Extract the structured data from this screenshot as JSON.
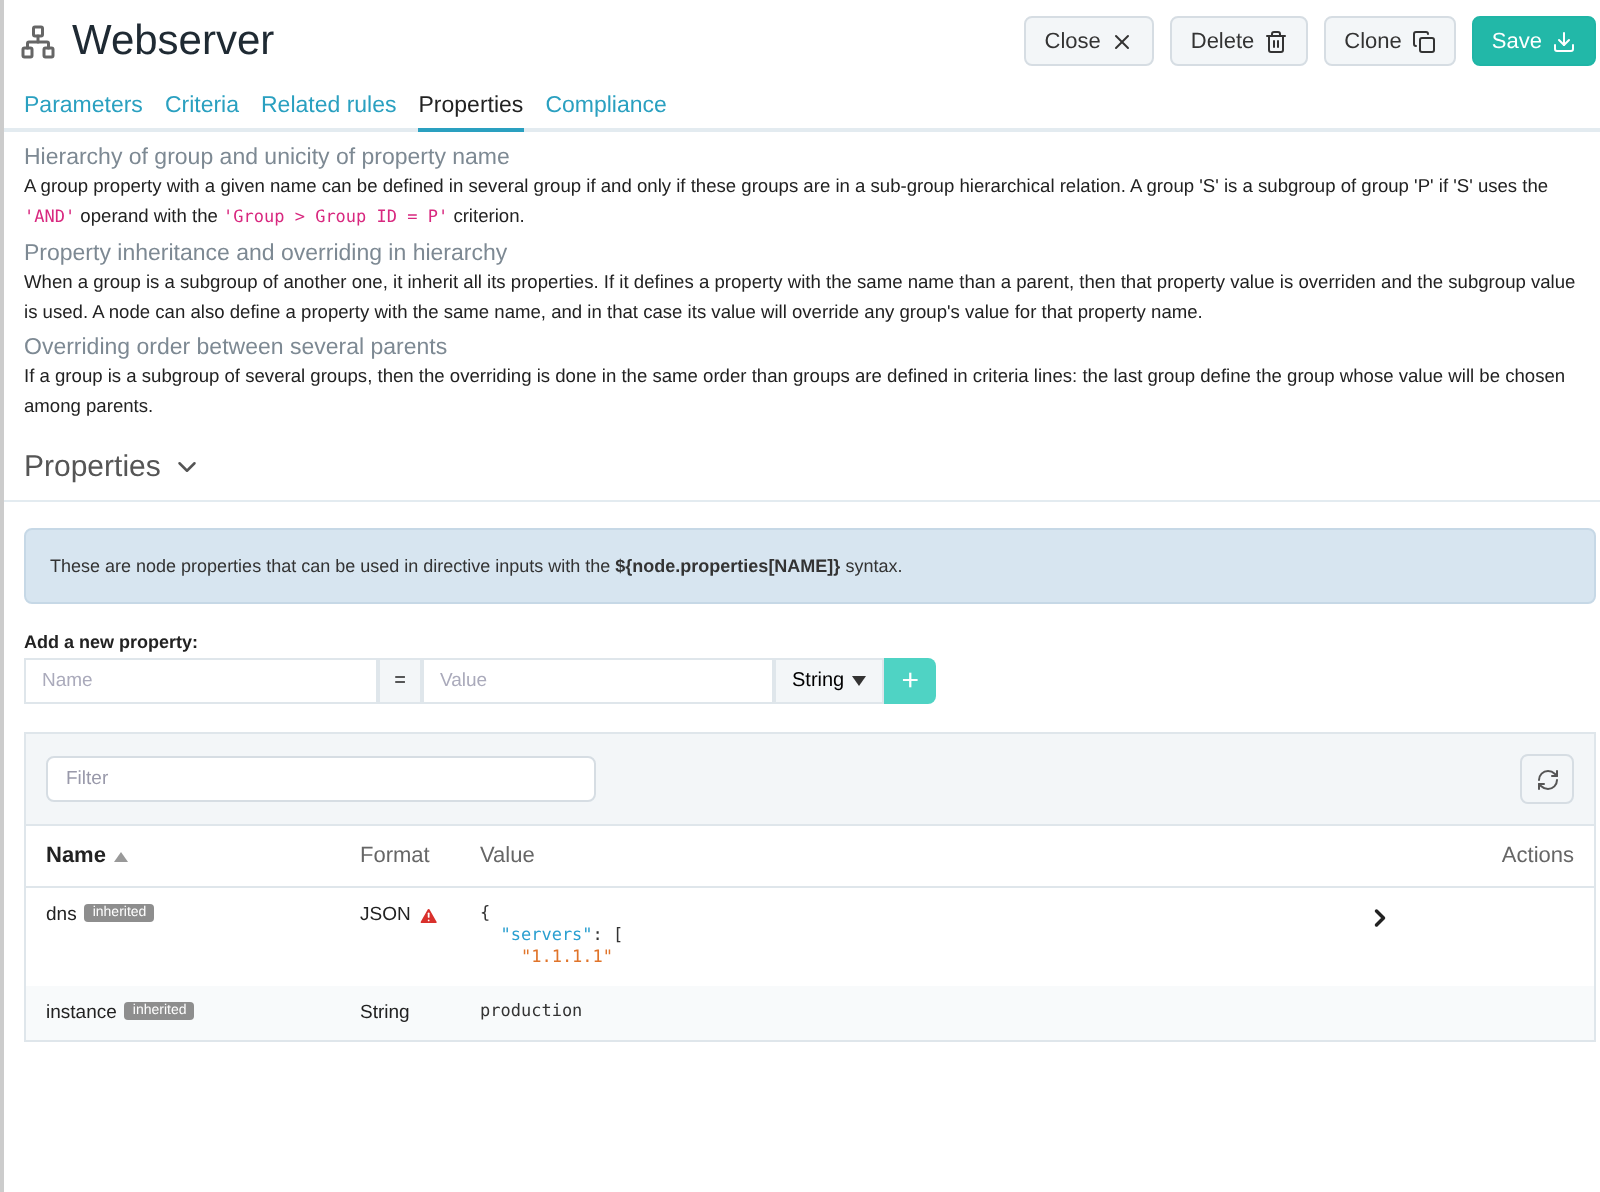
{
  "header": {
    "title": "Webserver",
    "buttons": [
      {
        "label": "Close",
        "kind": "close"
      },
      {
        "label": "Delete",
        "kind": "delete"
      },
      {
        "label": "Clone",
        "kind": "clone"
      },
      {
        "label": "Save",
        "kind": "save"
      }
    ]
  },
  "tabs": [
    {
      "label": "Parameters",
      "selected": false
    },
    {
      "label": "Criteria",
      "selected": false
    },
    {
      "label": "Related rules",
      "selected": false
    },
    {
      "label": "Properties",
      "selected": true
    },
    {
      "label": "Compliance",
      "selected": false
    }
  ],
  "help": [
    {
      "heading": "Hierarchy of group and unicity of property name",
      "parts": [
        {
          "kind": "text",
          "text": "A group property with a given name can be defined in several group if and only if these groups are in a sub-group hierarchical relation. A group 'S' is a subgroup of group 'P' if 'S' uses the "
        },
        {
          "kind": "code",
          "text": "'AND'"
        },
        {
          "kind": "text",
          "text": " operand with the "
        },
        {
          "kind": "code",
          "text": "'Group > Group ID = P'"
        },
        {
          "kind": "text",
          "text": " criterion."
        }
      ]
    },
    {
      "heading": "Property inheritance and overriding in hierarchy",
      "parts": [
        {
          "kind": "text",
          "text": "When a group is a subgroup of another one, it inherit all its properties. If it defines a property with the same name than a parent, then that property value is overriden and the subgroup value is used. A node can also define a property with the same name, and in that case its value will override any group's value for that property name."
        }
      ]
    },
    {
      "heading": "Overriding order between several parents",
      "parts": [
        {
          "kind": "text",
          "text": "If a group is a subgroup of several groups, then the overriding is done in the same order than groups are defined in criteria lines: the last group define the group whose value will be chosen among parents."
        }
      ]
    }
  ],
  "section": {
    "title": "Properties",
    "expanded": true
  },
  "info": "These are node properties that can be used in directive inputs with the **${node.properties[NAME]}** syntax.",
  "add_form": {
    "label": "Add a new property:",
    "name_placeholder": "Name",
    "equals": "=",
    "value_placeholder": "Value",
    "format": "String",
    "add": "+"
  },
  "table": {
    "filter_placeholder": "Filter",
    "columns": [
      "Name",
      "Format",
      "Value",
      "Actions"
    ],
    "rows": [
      {
        "name": "dns",
        "badge": "inherited",
        "format": "JSON",
        "warning": true,
        "value": [
          [
            {
              "kind": "punct",
              "text": "{"
            }
          ],
          [
            {
              "kind": "key",
              "text": "  \"servers\""
            },
            {
              "kind": "punct",
              "text": ": ["
            }
          ],
          [
            {
              "kind": "string",
              "text": "    \"1.1.1.1\""
            }
          ]
        ],
        "expandable": true
      },
      {
        "name": "instance",
        "badge": "inherited",
        "format": "String",
        "warning": false,
        "value": [
          [
            {
              "kind": "punct",
              "text": "production"
            }
          ]
        ],
        "expandable": false
      }
    ]
  }
}
